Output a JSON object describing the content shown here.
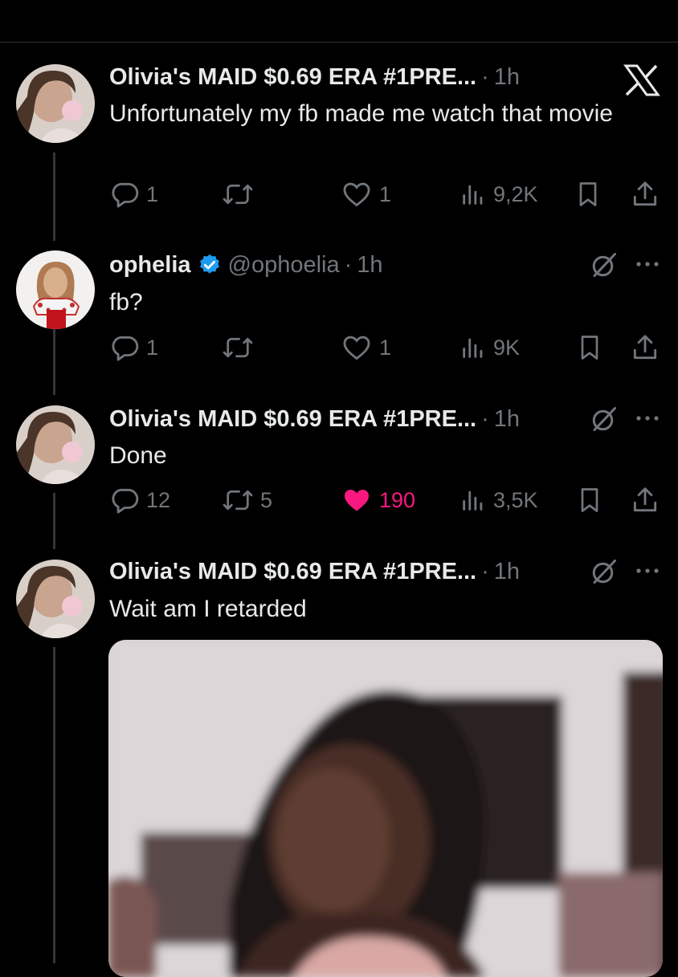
{
  "posts": [
    {
      "display_name": "Olivia's MAID $0.69 ERA #1PRE...",
      "time": "1h",
      "text": "Unfortunately my fb made me watch that movie",
      "replies": "1",
      "reposts": "",
      "likes": "1",
      "views": "9,2K",
      "liked": false
    },
    {
      "display_name": "ophelia",
      "handle": "@ophoelia",
      "time": "1h",
      "text": "fb?",
      "replies": "1",
      "reposts": "",
      "likes": "1",
      "views": "9K",
      "liked": false
    },
    {
      "display_name": "Olivia's MAID $0.69 ERA #1PRE...",
      "time": "1h",
      "text": "Done",
      "replies": "12",
      "reposts": "5",
      "likes": "190",
      "views": "3,5K",
      "liked": true
    },
    {
      "display_name": "Olivia's MAID $0.69 ERA #1PRE...",
      "time": "1h",
      "text": "Wait am I retarded"
    }
  ],
  "separator": "·",
  "colors": {
    "background": "#000000",
    "text": "#e7e9ea",
    "muted": "#71767b",
    "like": "#f91880",
    "verified": "#1d9bf0"
  },
  "icons": [
    "x-logo-icon",
    "reply-icon",
    "repost-icon",
    "heart-icon",
    "views-icon",
    "bookmark-icon",
    "share-icon",
    "grok-icon",
    "more-icon",
    "verified-badge-icon"
  ]
}
